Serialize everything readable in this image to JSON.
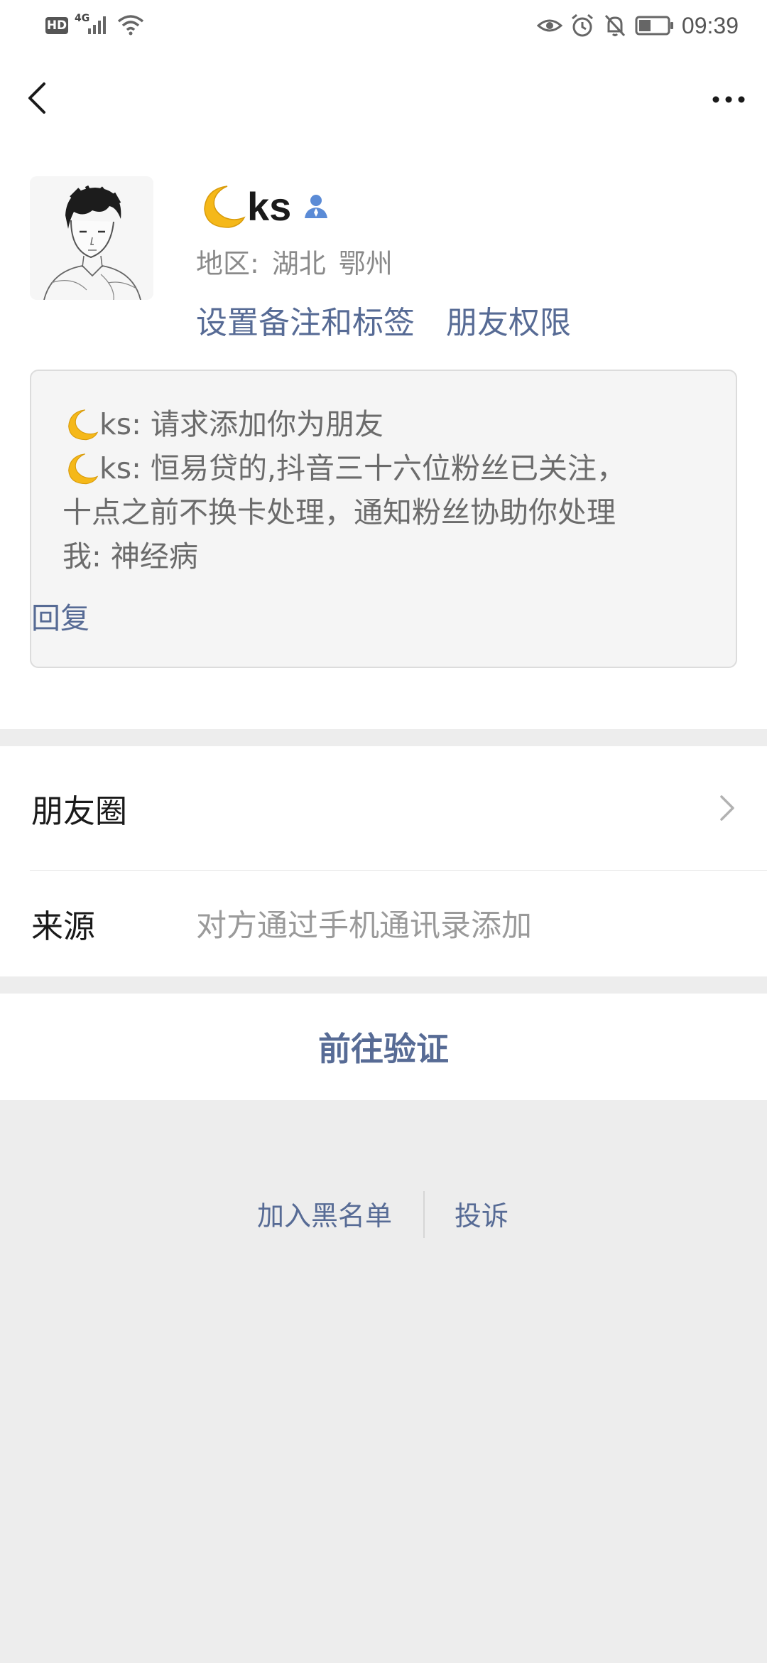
{
  "status_bar": {
    "hd": "HD",
    "network": "4G",
    "time": "09:39"
  },
  "profile": {
    "name": "ks",
    "region_label": "地区:",
    "region_province": "湖北",
    "region_city": "鄂州",
    "set_remark_label": "设置备注和标签",
    "friend_permission_label": "朋友权限"
  },
  "messages": {
    "line1": "ks: 请求添加你为朋友",
    "line2": "ks: 恒易贷的,抖音三十六位粉丝已关注，",
    "line3": "十点之前不换卡处理，通知粉丝协助你处理",
    "line4": "我: 神经病",
    "reply": "回复"
  },
  "list": {
    "moments_label": "朋友圈",
    "source_label": "来源",
    "source_value": "对方通过手机通讯录添加"
  },
  "verify_button": "前往验证",
  "bottom": {
    "blacklist": "加入黑名单",
    "complain": "投诉"
  },
  "icons": {
    "back": "back-arrow-icon",
    "more": "more-dots-icon",
    "moon": "crescent-moon-emoji",
    "person": "contact-person-icon",
    "chevron": "chevron-right-icon"
  },
  "colors": {
    "link_blue": "#576b95",
    "background_gray": "#ededed",
    "moon_yellow": "#f5b819"
  }
}
